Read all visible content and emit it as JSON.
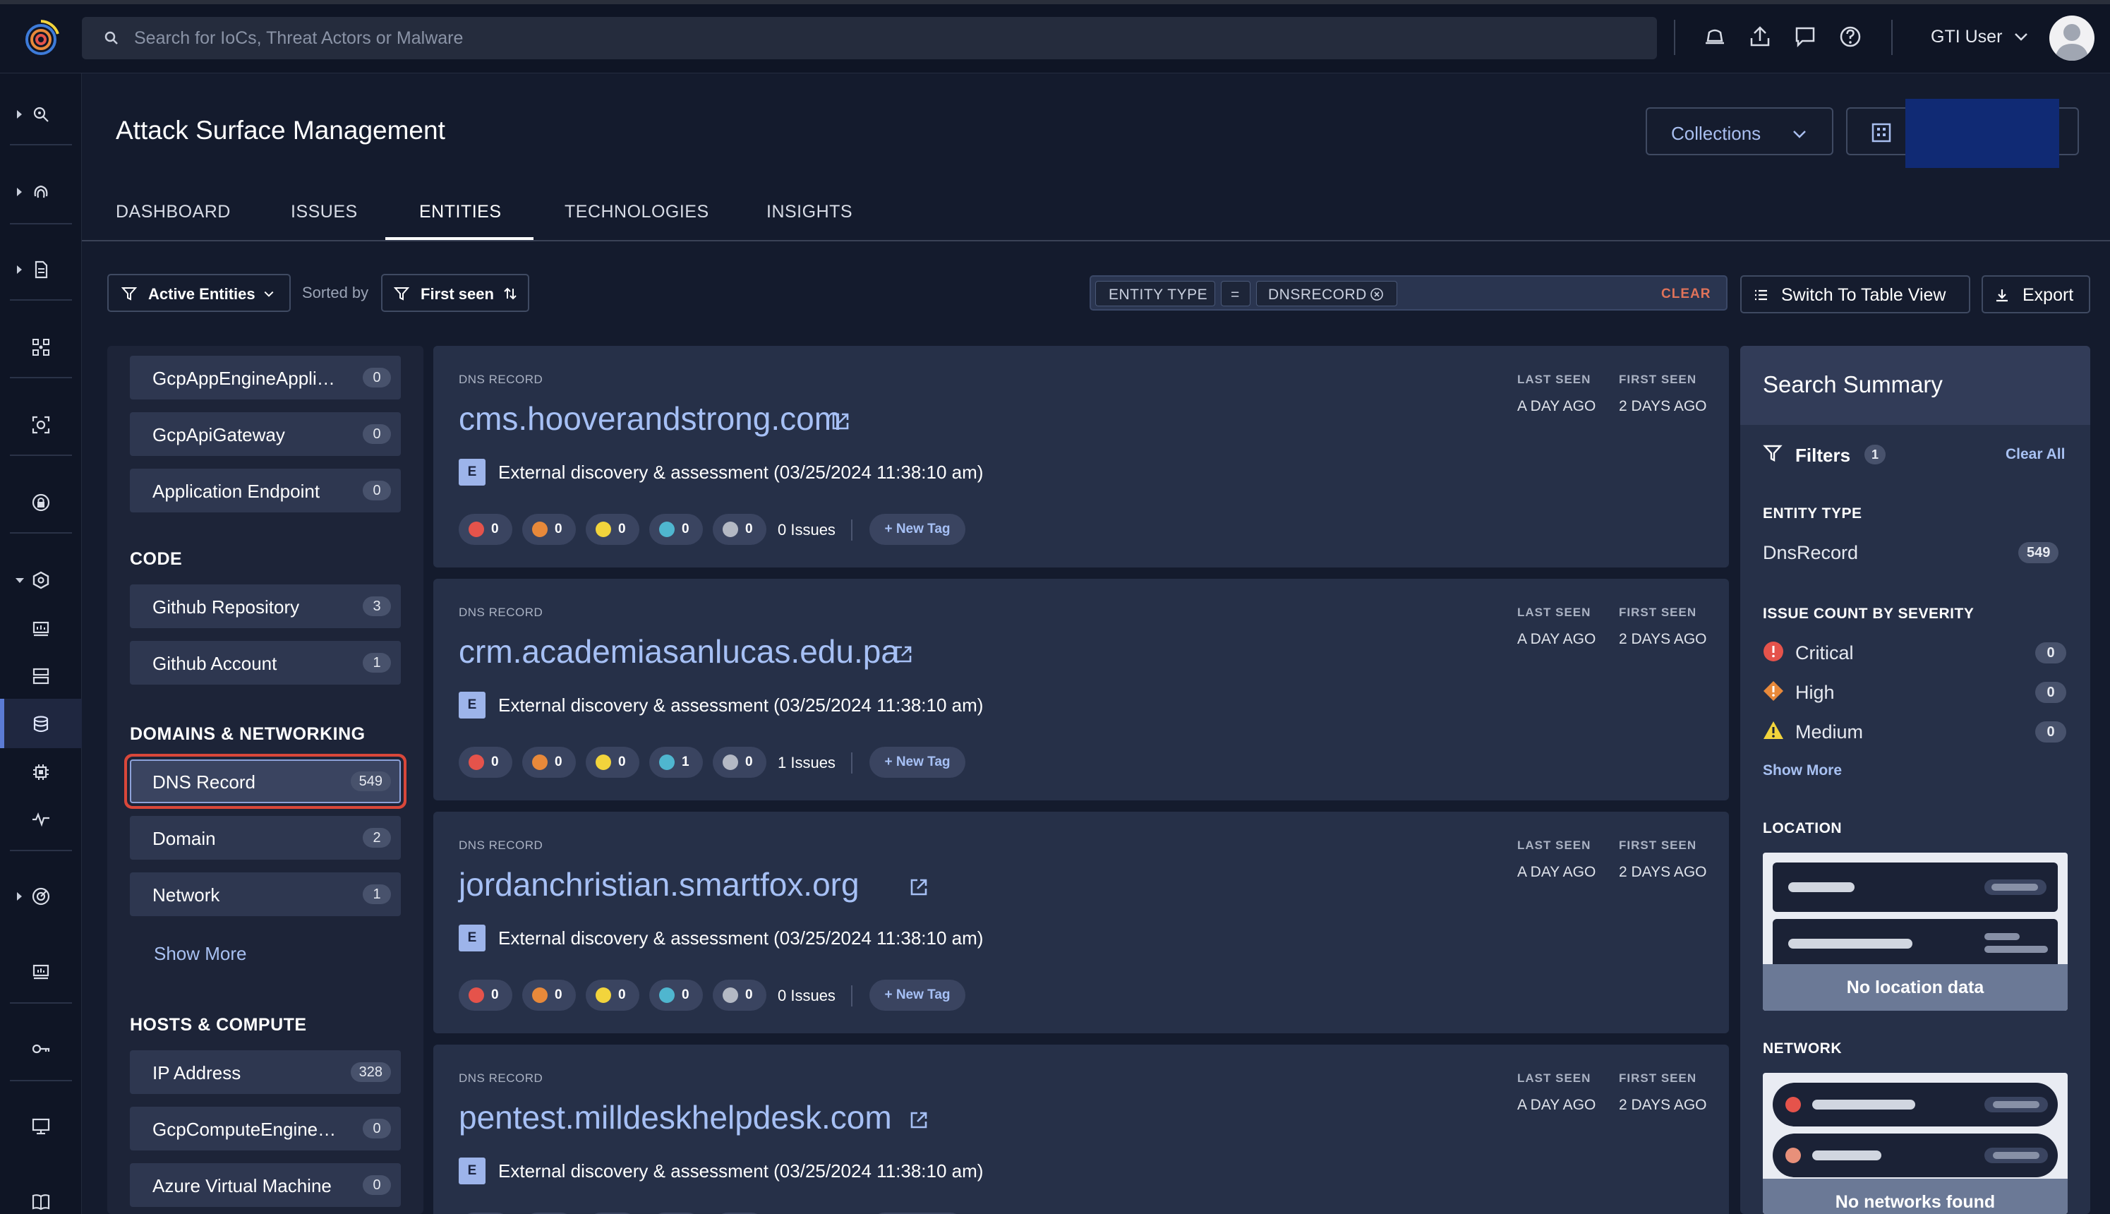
{
  "search": {
    "placeholder": "Search for IoCs, Threat Actors or Malware"
  },
  "user": {
    "name": "GTI User"
  },
  "page": {
    "title": "Attack Surface Management"
  },
  "header_buttons": {
    "collections": "Collections"
  },
  "tabs": [
    {
      "label": "DASHBOARD"
    },
    {
      "label": "ISSUES"
    },
    {
      "label": "ENTITIES",
      "active": true
    },
    {
      "label": "TECHNOLOGIES"
    },
    {
      "label": "INSIGHTS"
    }
  ],
  "toolbar": {
    "active_entities": "Active Entities",
    "sorted_by": "Sorted by",
    "sort_field": "First seen",
    "filter_key": "ENTITY TYPE",
    "filter_op": "=",
    "filter_value": "DNSRECORD",
    "clear": "CLEAR",
    "switch_view": "Switch To Table View",
    "export": "Export"
  },
  "facets": {
    "top_items": [
      {
        "label": "GcpAppEngineAppli…",
        "count": "0"
      },
      {
        "label": "GcpApiGateway",
        "count": "0"
      },
      {
        "label": "Application Endpoint",
        "count": "0"
      }
    ],
    "code_heading": "CODE",
    "code_items": [
      {
        "label": "Github Repository",
        "count": "3"
      },
      {
        "label": "Github Account",
        "count": "1"
      }
    ],
    "domains_heading": "DOMAINS & NETWORKING",
    "domains_items": [
      {
        "label": "DNS Record",
        "count": "549",
        "selected": true
      },
      {
        "label": "Domain",
        "count": "2"
      },
      {
        "label": "Network",
        "count": "1"
      }
    ],
    "show_more": "Show More",
    "hosts_heading": "HOSTS & COMPUTE",
    "hosts_items": [
      {
        "label": "IP Address",
        "count": "328"
      },
      {
        "label": "GcpComputeEngine…",
        "count": "0"
      },
      {
        "label": "Azure Virtual Machine",
        "count": "0"
      }
    ]
  },
  "card_labels": {
    "kind": "DNS RECORD",
    "last_seen": "LAST SEEN",
    "first_seen": "FIRST SEEN",
    "e_badge": "E",
    "new_tag": "+ New Tag"
  },
  "severity_colors": [
    "#e5534b",
    "#e8893a",
    "#f2d43c",
    "#4fb6cf",
    "#b4b9c4"
  ],
  "cards": [
    {
      "host": "cms.hooverandstrong.com",
      "last_seen": "A DAY AGO",
      "first_seen": "2 DAYS AGO",
      "description": "External discovery & assessment (03/25/2024 11:38:10 am)",
      "severity_counts": [
        "0",
        "0",
        "0",
        "0",
        "0"
      ],
      "issues": "0 Issues"
    },
    {
      "host": "crm.academiasanlucas.edu.pa",
      "last_seen": "A DAY AGO",
      "first_seen": "2 DAYS AGO",
      "description": "External discovery & assessment (03/25/2024 11:38:10 am)",
      "severity_counts": [
        "0",
        "0",
        "0",
        "1",
        "0"
      ],
      "issues": "1 Issues"
    },
    {
      "host": "jordanchristian.smartfox.org",
      "last_seen": "A DAY AGO",
      "first_seen": "2 DAYS AGO",
      "description": "External discovery & assessment (03/25/2024 11:38:10 am)",
      "severity_counts": [
        "0",
        "0",
        "0",
        "0",
        "0"
      ],
      "issues": "0 Issues"
    },
    {
      "host": "pentest.milldeskhelpdesk.com",
      "last_seen": "A DAY AGO",
      "first_seen": "2 DAYS AGO",
      "description": "External discovery & assessment (03/25/2024 11:38:10 am)",
      "severity_counts": [
        "0",
        "0",
        "0",
        "0",
        "0"
      ],
      "issues": "0 Issues"
    }
  ],
  "summary": {
    "title": "Search Summary",
    "filters_label": "Filters",
    "filters_count": "1",
    "clear_all": "Clear All",
    "entity_type_heading": "ENTITY TYPE",
    "entity_type_label": "DnsRecord",
    "entity_type_count": "549",
    "severity_heading": "ISSUE COUNT BY SEVERITY",
    "severity_rows": [
      {
        "label": "Critical",
        "count": "0",
        "color": "#e5534b"
      },
      {
        "label": "High",
        "count": "0",
        "color": "#e8893a"
      },
      {
        "label": "Medium",
        "count": "0",
        "color": "#f2d43c"
      }
    ],
    "show_more": "Show More",
    "location_heading": "LOCATION",
    "no_location": "No location data",
    "network_heading": "NETWORK",
    "no_networks": "No networks found"
  }
}
